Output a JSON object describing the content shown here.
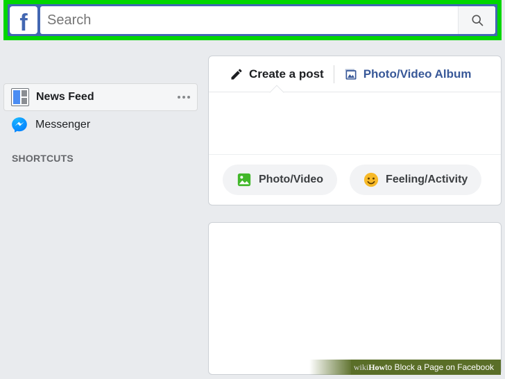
{
  "header": {
    "search_placeholder": "Search"
  },
  "sidebar": {
    "items": [
      {
        "label": "News Feed"
      },
      {
        "label": "Messenger"
      }
    ],
    "shortcuts_header": "SHORTCUTS"
  },
  "composer": {
    "tabs": {
      "create_post": "Create a post",
      "photo_album": "Photo/Video Album"
    },
    "actions": {
      "photo_video": "Photo/Video",
      "feeling_activity": "Feeling/Activity"
    }
  },
  "caption": {
    "brand_a": "wiki",
    "brand_b": "How",
    "text": " to Block a Page on Facebook"
  }
}
